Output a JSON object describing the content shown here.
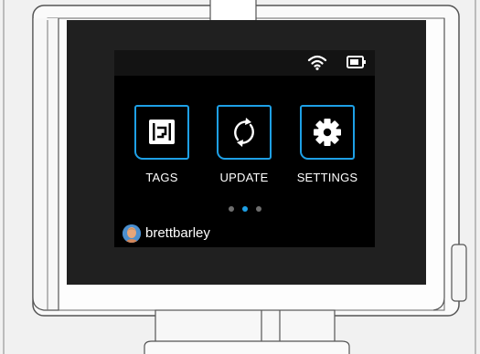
{
  "colors": {
    "accent": "#1ea0e6",
    "screen_bg": "#000000",
    "bezel": "#202020"
  },
  "status_bar": {
    "icons": [
      "wifi-icon",
      "battery-icon"
    ]
  },
  "menu": {
    "tiles": [
      {
        "label": "TAGS",
        "icon": "tag-icon"
      },
      {
        "label": "UPDATE",
        "icon": "sync-icon"
      },
      {
        "label": "SETTINGS",
        "icon": "gear-icon"
      }
    ]
  },
  "pagination": {
    "pages": 3,
    "current": 2
  },
  "user": {
    "name": "brettbarley"
  }
}
